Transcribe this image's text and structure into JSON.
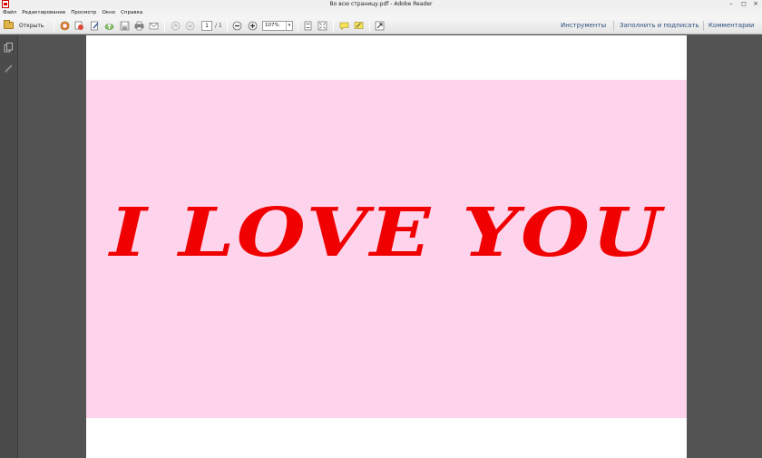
{
  "window": {
    "title": "Во всю страницу.pdf - Adobe Reader",
    "controls": {
      "minimize": "–",
      "maximize": "◻",
      "close": "×"
    }
  },
  "menu": [
    "Файл",
    "Редактирование",
    "Просмотр",
    "Окно",
    "Справка"
  ],
  "toolbar": {
    "open_label": "Открыть",
    "page_current": "1",
    "page_total": "/ 1",
    "zoom": "107%",
    "zoom_dropdown": "▾",
    "right_buttons": [
      "Инструменты",
      "Заполнить и подписать",
      "Комментарии"
    ]
  },
  "document": {
    "text": "I LOVE YOU",
    "colors": {
      "banner": "#fdd4ec",
      "text": "#f00000",
      "page": "#ffffff",
      "background": "#535353"
    }
  }
}
